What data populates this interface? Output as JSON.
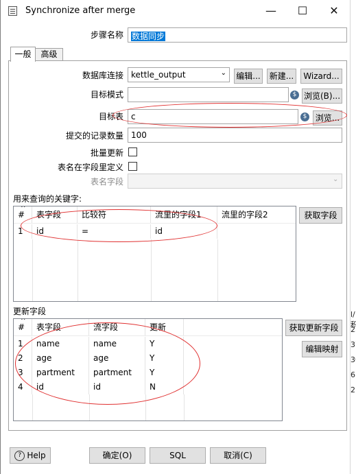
{
  "window": {
    "title": "Synchronize after merge",
    "minimize": "—",
    "maximize": "☐",
    "close": "✕"
  },
  "step_name": {
    "label": "步骤名称",
    "value": "数据同步"
  },
  "tabs": [
    {
      "label": "一般"
    },
    {
      "label": "高级"
    }
  ],
  "connection": {
    "label": "数据库连接",
    "value": "kettle_output",
    "edit_button": "编辑...",
    "new_button": "新建...",
    "wizard_button": "Wizard..."
  },
  "target_schema": {
    "label": "目标模式",
    "value": "",
    "browse_button": "浏览(B)..."
  },
  "target_table": {
    "label": "目标表",
    "value": "c",
    "browse_button": "浏览..."
  },
  "commit_size": {
    "label": "提交的记录数量",
    "value": "100"
  },
  "batch_update": {
    "label": "批量更新"
  },
  "table_name_in_field": {
    "label": "表名在字段里定义"
  },
  "table_name_field": {
    "label": "表名字段",
    "value": ""
  },
  "keys": {
    "section_label": "用来查询的关键字:",
    "get_fields_button": "获取字段",
    "columns": [
      "#",
      "表字段",
      "比较符",
      "流里的字段1",
      "流里的字段2"
    ],
    "rows": [
      {
        "num": "1",
        "table_field": "id",
        "comparator": "=",
        "stream_field1": "id",
        "stream_field2": ""
      }
    ]
  },
  "update": {
    "section_label": "更新字段",
    "get_update_fields_button": "获取更新字段",
    "edit_mapping_button": "编辑映射",
    "columns": [
      "#",
      "表字段",
      "流字段",
      "更新"
    ],
    "rows": [
      {
        "num": "1",
        "table_field": "name",
        "stream_field": "name",
        "update": "Y"
      },
      {
        "num": "2",
        "table_field": "age",
        "stream_field": "age",
        "update": "Y"
      },
      {
        "num": "3",
        "table_field": "partment",
        "stream_field": "partment",
        "update": "Y"
      },
      {
        "num": "4",
        "table_field": "id",
        "stream_field": "id",
        "update": "N"
      }
    ]
  },
  "footer": {
    "help_button": "Help",
    "ok_button": "确定(O)",
    "sql_button": "SQL",
    "cancel_button": "取消(C)"
  },
  "background_fragments": [
    "l/积",
    "25",
    "37",
    "30",
    "6",
    "2"
  ],
  "colors": {
    "annotation": "#e03030",
    "selection": "#0078d7",
    "variable_icon": "#4a6e93"
  }
}
